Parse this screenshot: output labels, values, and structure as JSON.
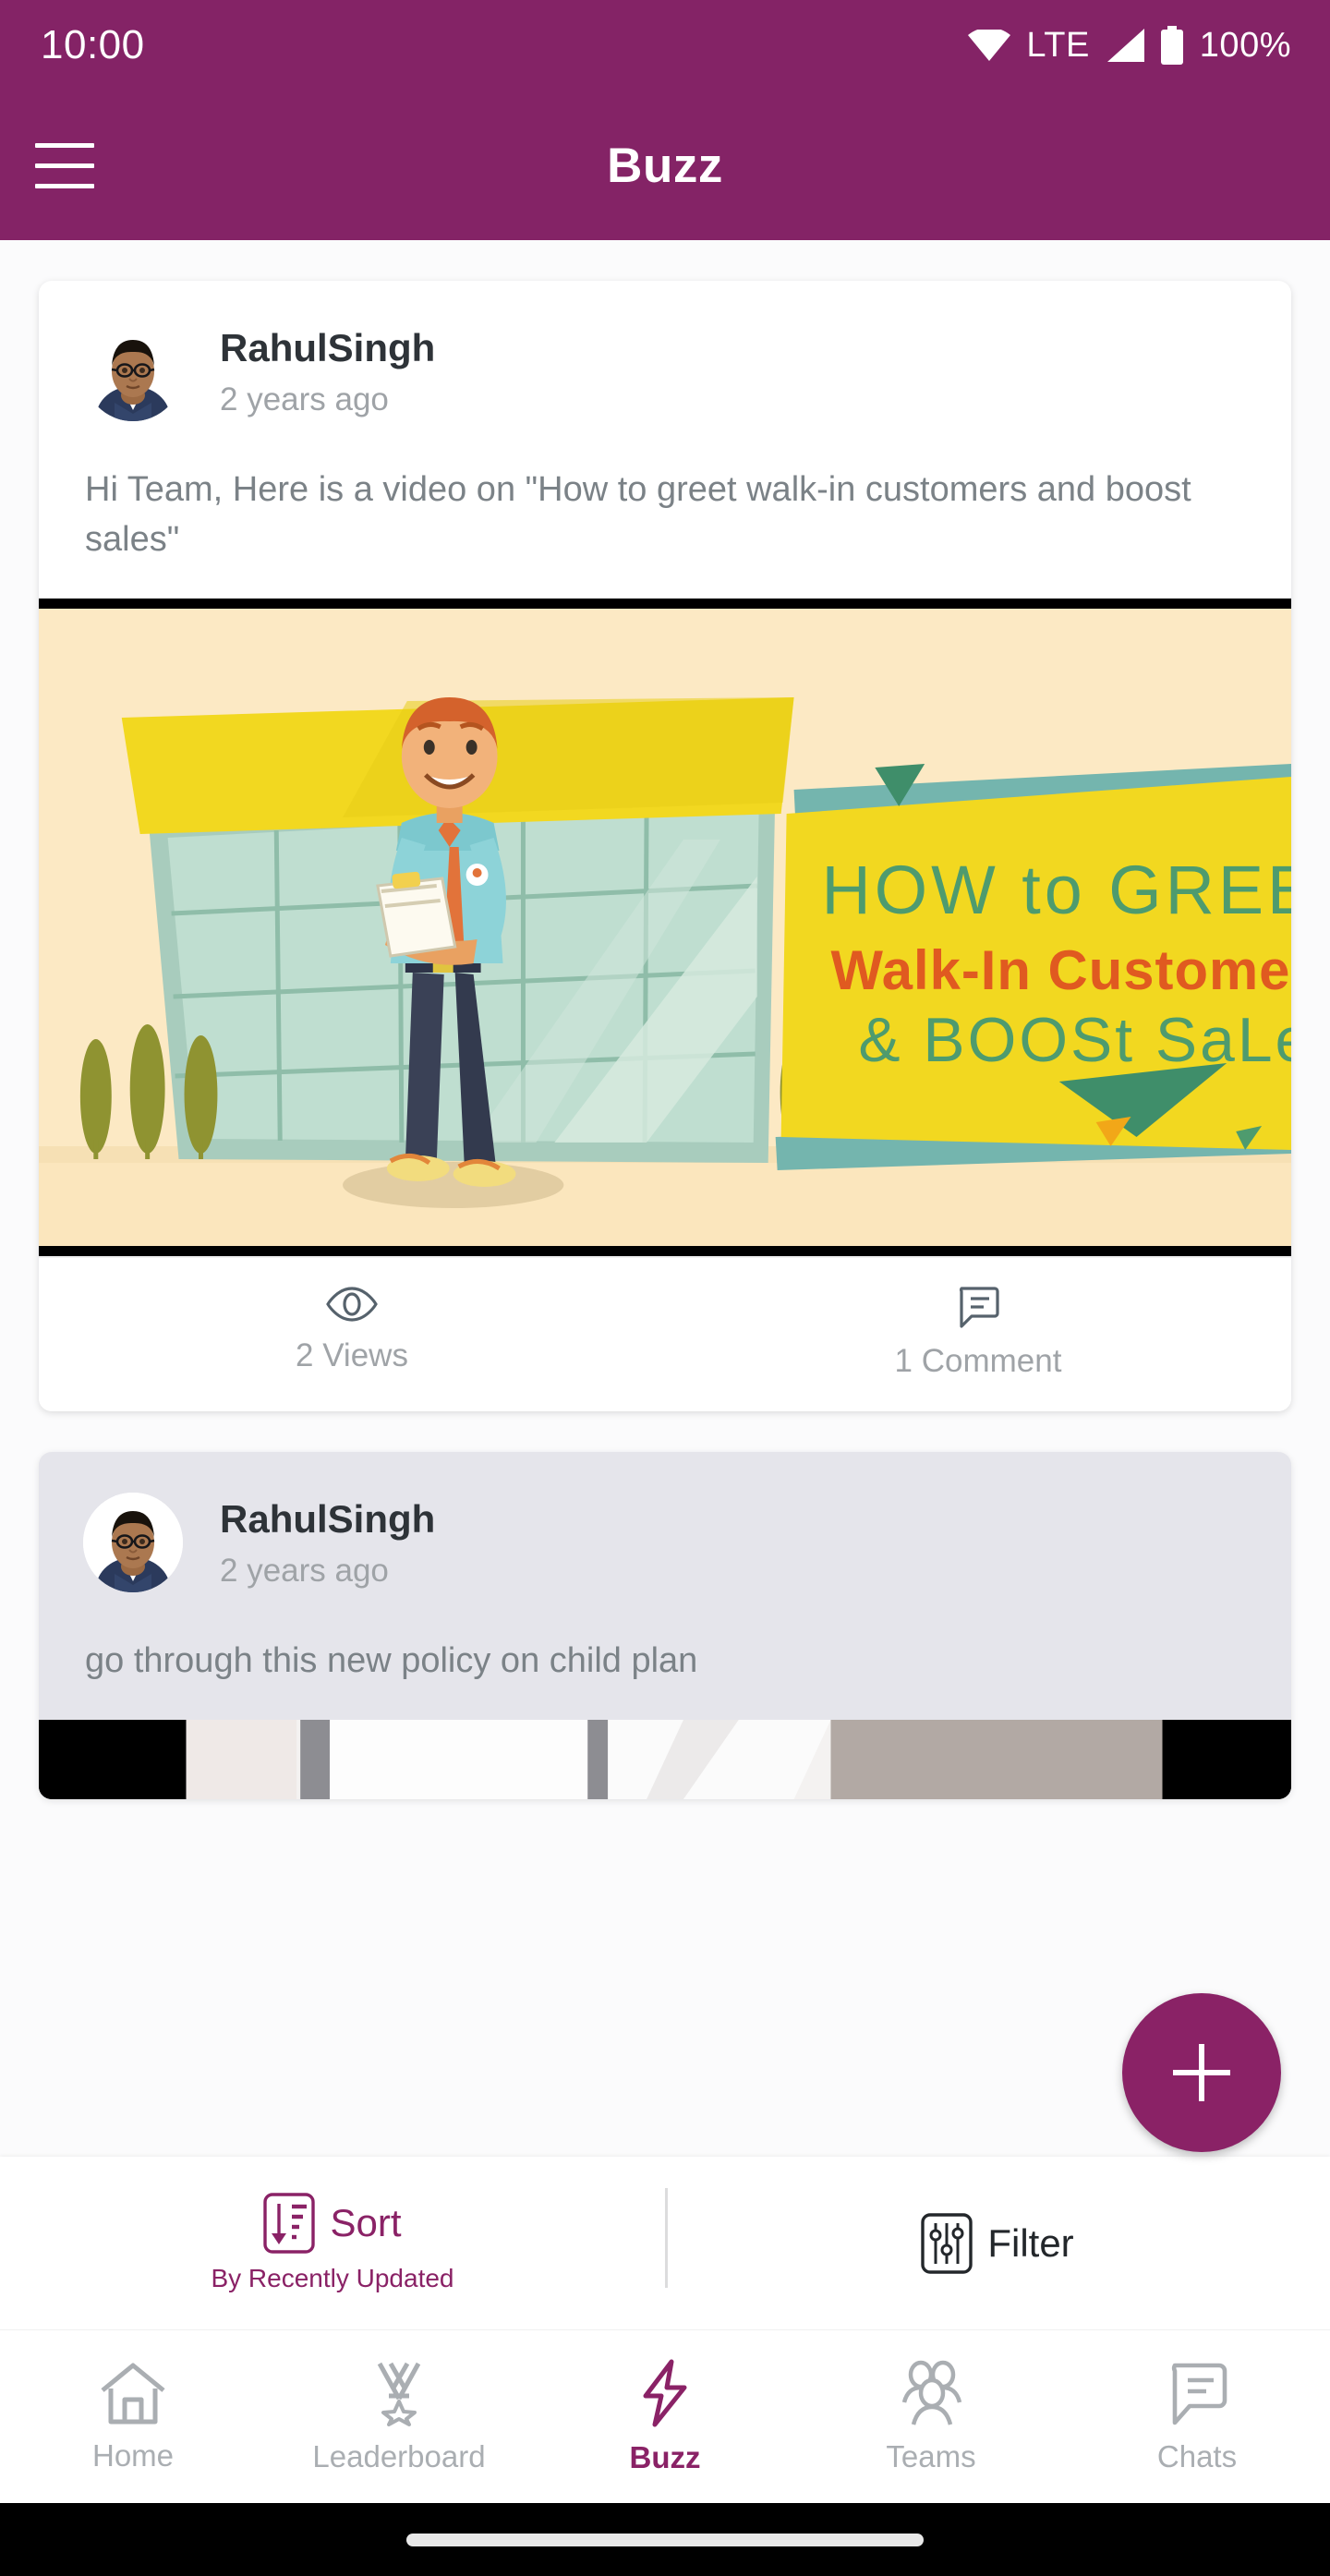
{
  "status_bar": {
    "time": "10:00",
    "network_type": "LTE",
    "battery_percent": "100%",
    "icons": [
      "wifi-icon",
      "signal-icon",
      "battery-icon"
    ]
  },
  "app_bar": {
    "title": "Buzz",
    "menu_icon": "hamburger-menu-icon"
  },
  "theme": {
    "brand_purple": "#842366",
    "fab_purple": "#8a2266",
    "muted_text": "#9fa3a7",
    "body_text": "#7b8287",
    "heading_text": "#2e3338",
    "page_bg": "#fbfbfc",
    "tinted_card_bg": "#e5e5eb"
  },
  "feed": {
    "posts": [
      {
        "author": "RahulSingh",
        "time": "2 years ago",
        "text": "Hi Team, Here is a video on \"How to greet walk-in customers and boost sales\"",
        "media_type": "video-thumbnail",
        "media_alt": "Cartoon salesman with clipboard in front of glass storefront",
        "media_banner": {
          "line1": "HOW to GREEt",
          "line2": "Walk-In Customers",
          "line3": "& BOOSt SaLes"
        },
        "actions": [
          {
            "icon": "eye-icon",
            "label": "2 Views"
          },
          {
            "icon": "comment-icon",
            "label": "1 Comment"
          }
        ]
      },
      {
        "author": "RahulSingh",
        "time": "2 years ago",
        "text": "go through this  new policy on child plan",
        "media_type": "photo",
        "media_alt": "Partially visible interior photograph"
      }
    ]
  },
  "fab": {
    "icon": "plus-icon",
    "label": "Add post"
  },
  "sort_bar": {
    "sort": {
      "icon": "sort-icon",
      "label": "Sort",
      "sublabel": "By Recently Updated"
    },
    "filter": {
      "icon": "filter-icon",
      "label": "Filter"
    }
  },
  "bottom_nav": {
    "items": [
      {
        "icon": "home-icon",
        "label": "Home",
        "active": false
      },
      {
        "icon": "medal-icon",
        "label": "Leaderboard",
        "active": false
      },
      {
        "icon": "lightning-icon",
        "label": "Buzz",
        "active": true
      },
      {
        "icon": "people-icon",
        "label": "Teams",
        "active": false
      },
      {
        "icon": "chat-bubble-icon",
        "label": "Chats",
        "active": false
      }
    ]
  }
}
